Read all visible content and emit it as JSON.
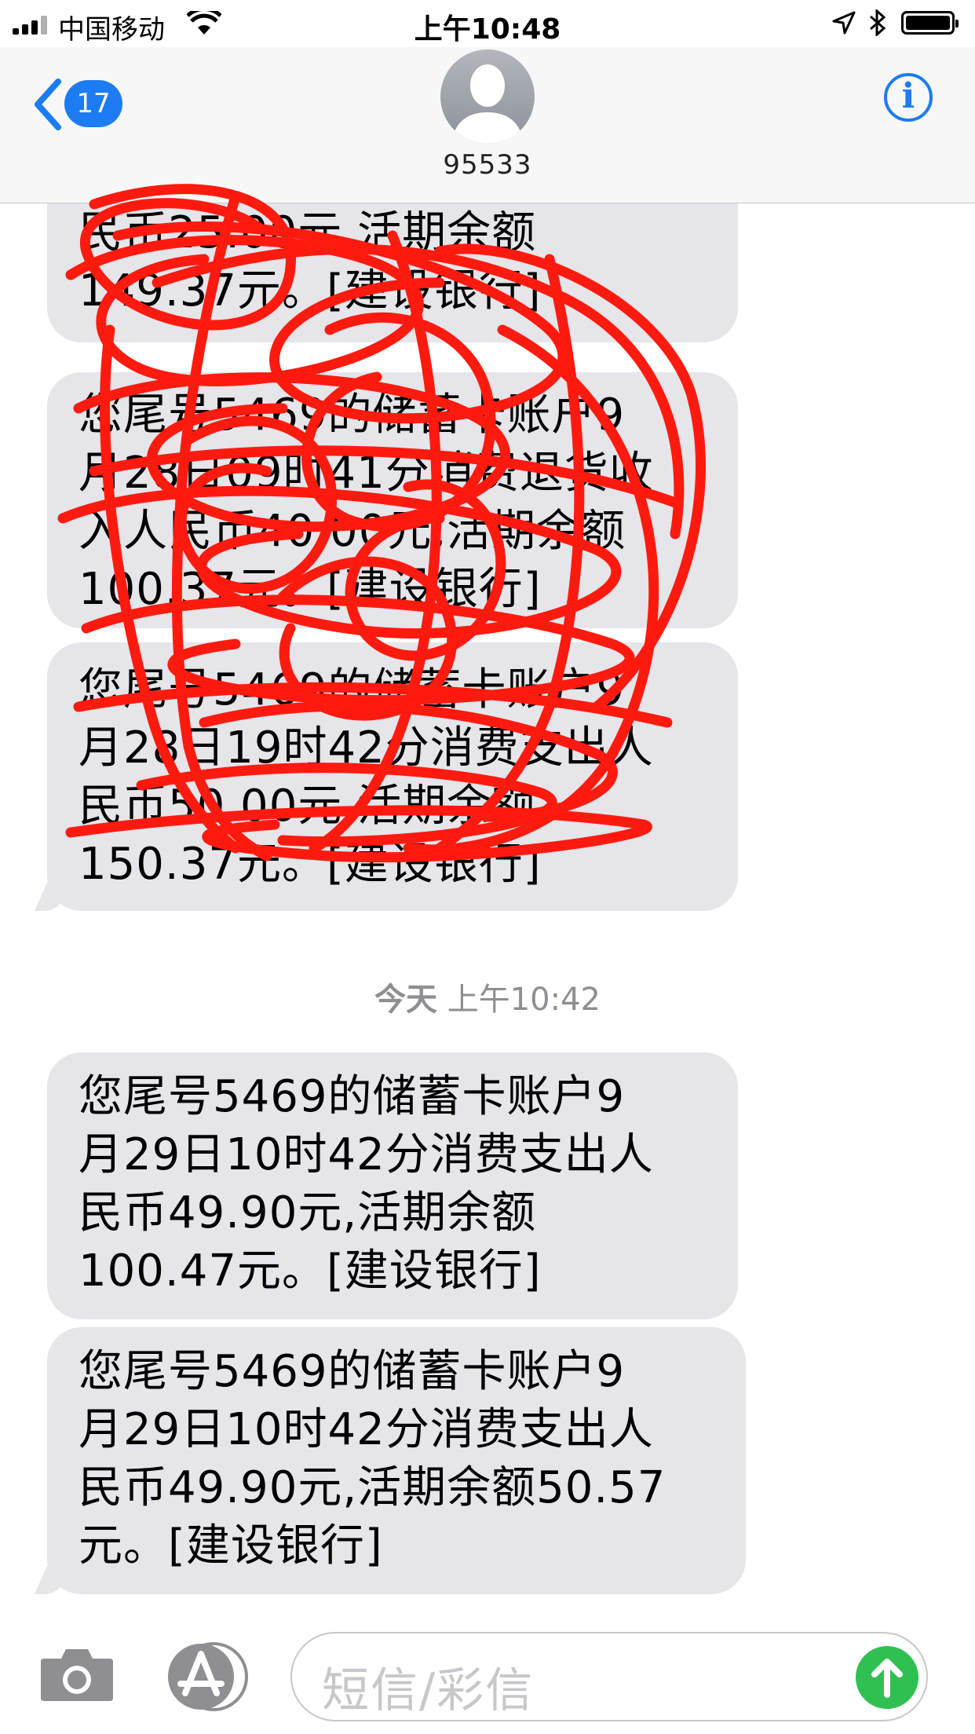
{
  "status_bar": {
    "carrier": "中国移动",
    "time": "上午10:48"
  },
  "nav": {
    "back_count": "17",
    "contact": "95533",
    "info_label": "i",
    "accent_color": "#1d7cf2"
  },
  "messages_obscured": [
    {
      "text": "民币25.00元,活期余额\n149.37元。[建设银行]"
    },
    {
      "text": "您尾号5469的储蓄卡账户9\n月28日09时41分消费退货收\n入人民币40.00元,活期余额\n100.37元。[建设银行]"
    },
    {
      "text": "您尾号5469的储蓄卡账户9\n月28日19时42分消费支出人\n民币50.00元,活期余额\n150.37元。[建设银行]"
    }
  ],
  "timestamp": {
    "day": "今天",
    "time": "上午10:42"
  },
  "messages": [
    {
      "text": "您尾号5469的储蓄卡账户9\n月29日10时42分消费支出人\n民币49.90元,活期余额\n100.47元。[建设银行]"
    },
    {
      "text": "您尾号5469的储蓄卡账户9\n月29日10时42分消费支出人\n民币49.90元,活期余额50.57\n元。[建设银行]"
    }
  ],
  "input": {
    "placeholder": "短信/彩信",
    "send_color": "#30c052"
  },
  "colors": {
    "bubble": "#e5e5ea",
    "scribble": "#ff1a0f"
  }
}
